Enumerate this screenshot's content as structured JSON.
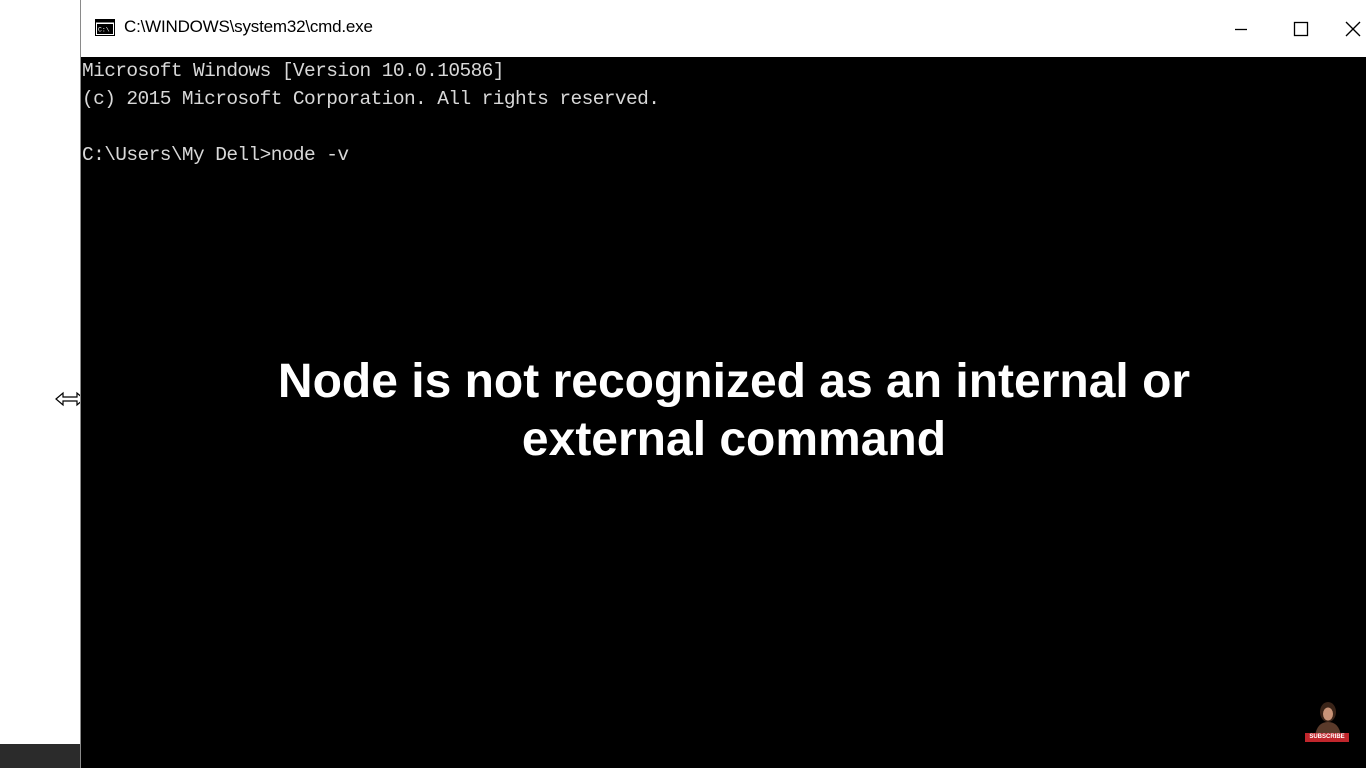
{
  "window": {
    "title": "C:\\WINDOWS\\system32\\cmd.exe",
    "icon": "cmd-icon",
    "controls": [
      "minimize-icon",
      "maximize-icon",
      "close-icon"
    ]
  },
  "console": {
    "lines": [
      "Microsoft Windows [Version 10.0.10586]",
      "(c) 2015 Microsoft Corporation. All rights reserved.",
      "",
      "C:\\Users\\My Dell>node -v"
    ],
    "text_color": "#d8d8d8",
    "background": "#000000"
  },
  "overlay": {
    "line1": "Node is not recognized as an internal or",
    "line2": "external command"
  },
  "badge": {
    "label": "SUBSCRIBE"
  },
  "colors": {
    "titlebar": "#ffffff",
    "desktop": "#ffffff",
    "badge_red": "#c0262c"
  }
}
